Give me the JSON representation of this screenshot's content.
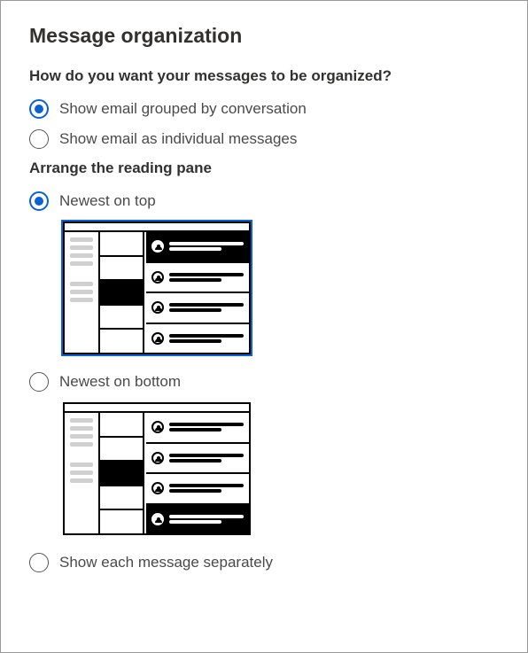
{
  "title": "Message organization",
  "section1": {
    "heading": "How do you want your messages to be organized?",
    "options": [
      {
        "label": "Show email grouped by conversation",
        "selected": true
      },
      {
        "label": "Show email as individual messages",
        "selected": false
      }
    ]
  },
  "section2": {
    "heading": "Arrange the reading pane",
    "options": [
      {
        "label": "Newest on top",
        "selected": true
      },
      {
        "label": "Newest on bottom",
        "selected": false
      },
      {
        "label": "Show each message separately",
        "selected": false
      }
    ]
  }
}
